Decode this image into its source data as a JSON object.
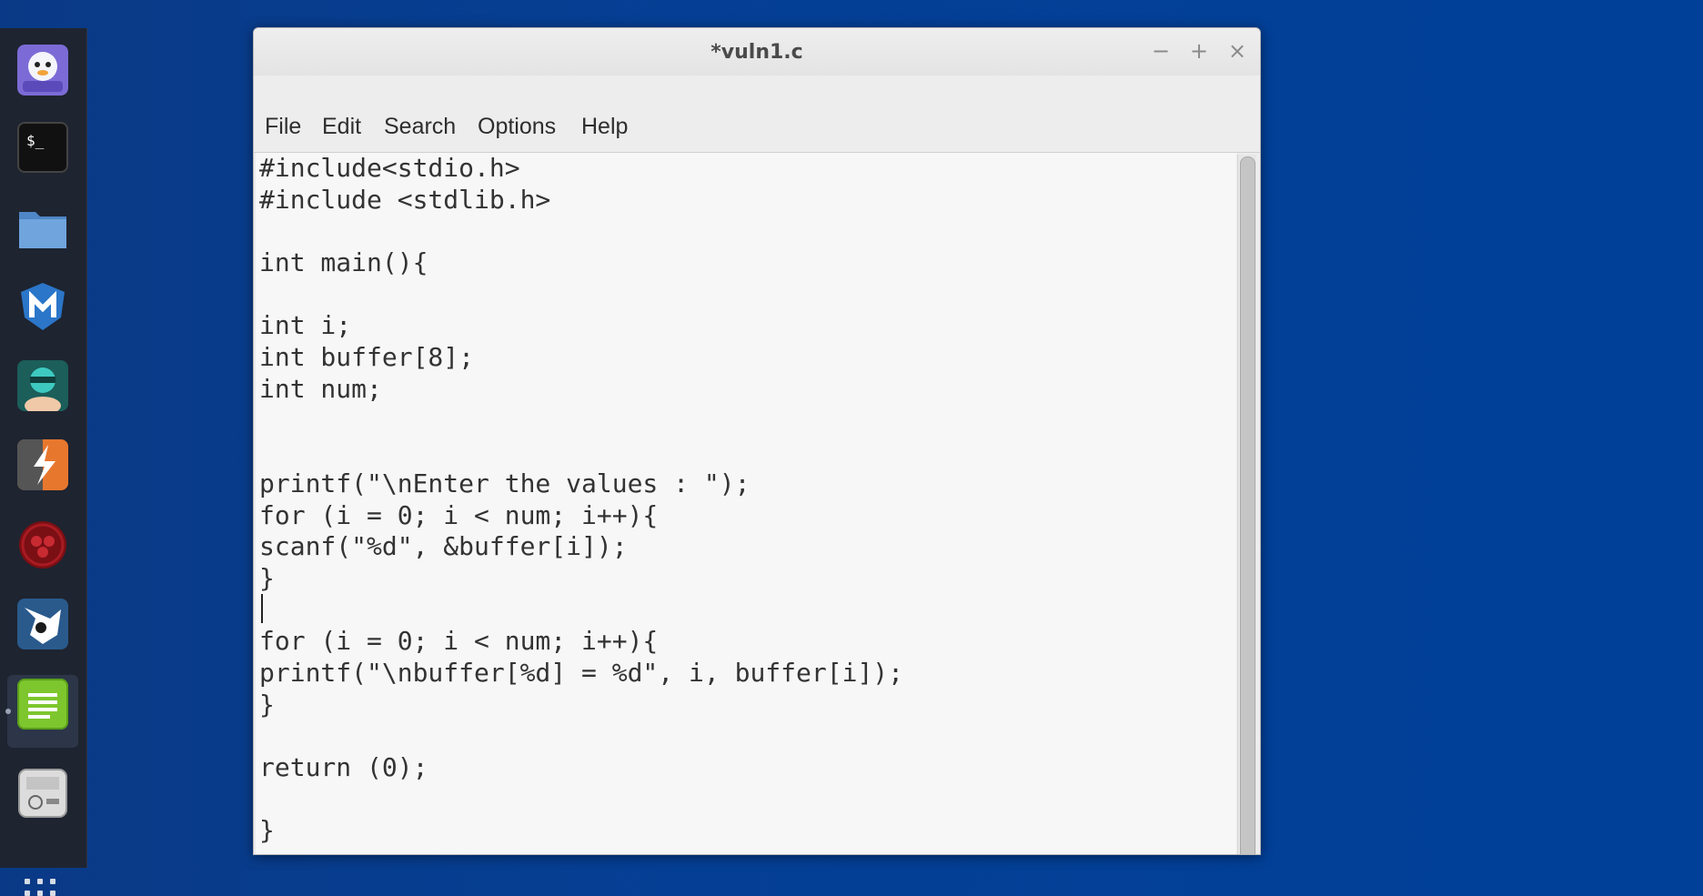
{
  "window": {
    "title": "*vuln1.c",
    "minimize_glyph": "−",
    "maximize_glyph": "+",
    "close_glyph": "×"
  },
  "menu": {
    "items": [
      "File",
      "Edit",
      "Search",
      "Options",
      "Help"
    ]
  },
  "editor": {
    "lines": [
      "#include<stdio.h>",
      "#include <stdlib.h>",
      "",
      "int main(){",
      "",
      "int i;",
      "int buffer[8];",
      "int num;",
      "",
      "",
      "printf(\"\\nEnter the values : \");",
      "for (i = 0; i < num; i++){",
      "scanf(\"%d\", &buffer[i]);",
      "}",
      "",
      "for (i = 0; i < num; i++){",
      "printf(\"\\nbuffer[%d] = %d\", i, buffer[i]);",
      "}",
      "",
      "return (0);",
      "",
      "}"
    ]
  },
  "dock": {
    "icons": [
      "pidgin-icon",
      "terminal-icon",
      "files-icon",
      "metasploit-icon",
      "armitage-icon",
      "burpsuite-icon",
      "faraday-icon",
      "beef-icon",
      "text-editor-icon",
      "settings-icon"
    ]
  },
  "colors": {
    "desktop": "#0a3f95",
    "dock_bg": "#1e2430",
    "editor_bg": "#f7f7f7"
  }
}
